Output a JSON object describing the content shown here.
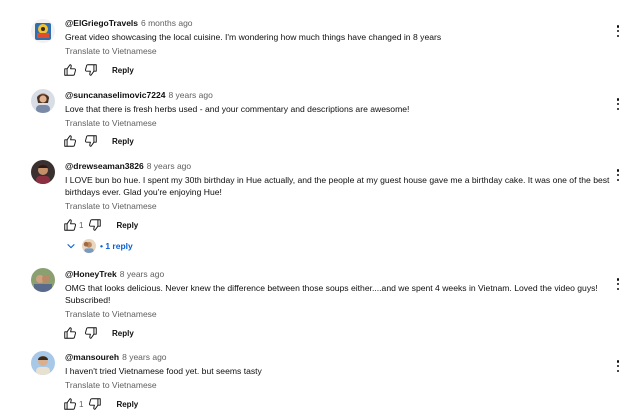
{
  "comments": [
    {
      "author": "@ElGriegoTravels",
      "time": "6 months ago",
      "text": "Great video showcasing the local cuisine. I'm wondering how much things have changed in 8 years",
      "translate": "Translate to Vietnamese",
      "likes": "",
      "reply_label": "Reply"
    },
    {
      "author": "@suncanaselimovic7224",
      "time": "8 years ago",
      "text": "Love that there is fresh herbs used - and your commentary and descriptions are awesome!",
      "translate": "Translate to Vietnamese",
      "likes": "",
      "reply_label": "Reply"
    },
    {
      "author": "@drewseaman3826",
      "time": "8 years ago",
      "text": "I LOVE bun bo hue. I spent my 30th birthday in Hue actually, and the people at my guest house gave me a birthday cake. It was one of the best birthdays ever. Glad you're enjoying Hue!",
      "translate": "Translate to Vietnamese",
      "likes": "1",
      "reply_label": "Reply",
      "replies_label": "• 1 reply"
    },
    {
      "author": "@HoneyTrek",
      "time": "8 years ago",
      "text": "OMG that looks delicious. Never knew the difference between those soups either....and we spent 4 weeks in Vietnam. Loved the video guys! Subscribed!",
      "translate": "Translate to Vietnamese",
      "likes": "",
      "reply_label": "Reply"
    },
    {
      "author": "@mansoureh",
      "time": "8 years ago",
      "text": "I haven't tried Vietnamese food yet. but seems tasty",
      "translate": "Translate to Vietnamese",
      "likes": "1",
      "reply_label": "Reply"
    }
  ],
  "colors": {
    "text": "#0f0f0f",
    "secondary": "#606060",
    "link": "#065fd4"
  },
  "icons": [
    "thumb-up-icon",
    "thumb-down-icon",
    "more-vert-icon",
    "chevron-down-icon"
  ]
}
